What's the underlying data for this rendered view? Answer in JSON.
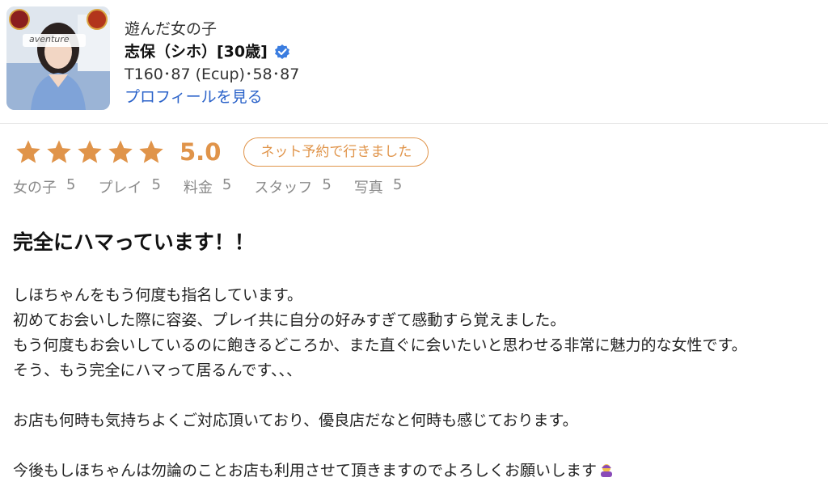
{
  "profile": {
    "photo_alt": "aventure",
    "played_label": "遊んだ女の子",
    "name": "志保（シホ）[30歳]",
    "measurements": "T160･87 (Ecup)･58･87",
    "profile_link": "プロフィールを見る"
  },
  "rating": {
    "stars": 5,
    "score": "5.0",
    "badge": "ネット予約で行きました",
    "subscores": [
      {
        "label": "女の子",
        "value": "5"
      },
      {
        "label": "プレイ",
        "value": "5"
      },
      {
        "label": "料金",
        "value": "5"
      },
      {
        "label": "スタッフ",
        "value": "5"
      },
      {
        "label": "写真",
        "value": "5"
      }
    ]
  },
  "review": {
    "title": "完全にハマっています！！",
    "paragraphs": [
      "しほちゃんをもう何度も指名しています。",
      "初めてお会いした際に容姿、プレイ共に自分の好みすぎて感動すら覚えました。",
      "もう何度もお会いしているのに飽きるどころか、また直ぐに会いたいと思わせる非常に魅力的な女性です。",
      "そう、もう完全にハマって居るんです、、、",
      "",
      "お店も何時も気持ちよくご対応頂いており、優良店だなと何時も感じております。",
      "",
      "今後もしほちゃんは勿論のことお店も利用させて頂きますのでよろしくお願いします"
    ]
  },
  "colors": {
    "accent": "#e0944a",
    "link": "#2a62c9",
    "verified": "#3b7de0"
  },
  "icons": {
    "verified": "verified-check-icon",
    "star": "star-icon",
    "emoji": "bowing-person-emoji"
  }
}
